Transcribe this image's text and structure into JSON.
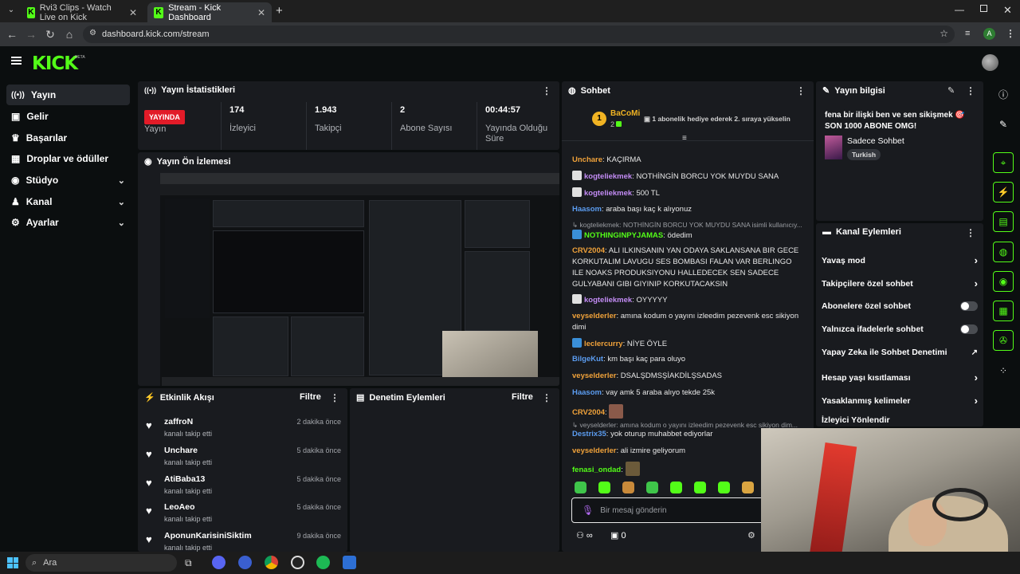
{
  "browser": {
    "tabs": [
      {
        "title": "Rvi3 Clips - Watch Live on Kick",
        "active": false
      },
      {
        "title": "Stream - Kick Dashboard",
        "active": true
      }
    ],
    "url": "dashboard.kick.com/stream",
    "profile_initial": "A"
  },
  "kick": {
    "logo": "KICK",
    "logo_suffix": "BETA"
  },
  "sidebar": {
    "items": [
      {
        "label": "Yayın",
        "icon": "broadcast-icon",
        "active": true,
        "chevron": false
      },
      {
        "label": "Gelir",
        "icon": "revenue-icon",
        "active": false,
        "chevron": false
      },
      {
        "label": "Başarılar",
        "icon": "trophy-icon",
        "active": false,
        "chevron": false
      },
      {
        "label": "Droplar ve ödüller",
        "icon": "gift-icon",
        "active": false,
        "chevron": false
      },
      {
        "label": "Stüdyo",
        "icon": "studio-icon",
        "active": false,
        "chevron": true
      },
      {
        "label": "Kanal",
        "icon": "channel-icon",
        "active": false,
        "chevron": true
      },
      {
        "label": "Ayarlar",
        "icon": "settings-icon",
        "active": false,
        "chevron": true
      }
    ]
  },
  "stats": {
    "title": "Yayın İstatistikleri",
    "live_badge": "YAYINDA",
    "items": [
      {
        "value": "",
        "label": "Yayın"
      },
      {
        "value": "174",
        "label": "İzleyici"
      },
      {
        "value": "1.943",
        "label": "Takipçi"
      },
      {
        "value": "2",
        "label": "Abone Sayısı"
      },
      {
        "value": "00:44:57",
        "label": "Yayında Olduğu Süre"
      }
    ]
  },
  "preview": {
    "title": "Yayın Ön İzlemesi"
  },
  "activity": {
    "title": "Etkinlik Akışı",
    "filter": "Filtre",
    "items": [
      {
        "name": "zaffroN",
        "action": "kanalı takip etti",
        "time": "2 dakika önce"
      },
      {
        "name": "Unchare",
        "action": "kanalı takip etti",
        "time": "5 dakika önce"
      },
      {
        "name": "AtiBaba13",
        "action": "kanalı takip etti",
        "time": "5 dakika önce"
      },
      {
        "name": "LeoAeo",
        "action": "kanalı takip etti",
        "time": "5 dakika önce"
      },
      {
        "name": "AponunKarisiniSiktim",
        "action": "kanalı takip etti",
        "time": "9 dakika önce"
      }
    ]
  },
  "moderation": {
    "title": "Denetim Eylemleri",
    "filter": "Filtre"
  },
  "chat": {
    "title": "Sohbet",
    "pinned_user": "BaCoMi",
    "pinned_count": "2",
    "pinned_rank": "1",
    "pinned_text": "1 abonelik hediye ederek 2. sıraya yükselin",
    "messages": [
      {
        "user": "Unchare",
        "color": "#f0a23a",
        "text": "KAÇIRMA"
      },
      {
        "user": "kogteliekmek",
        "color": "#c38cf5",
        "text": "NOTHİNGİN BORCU YOK MUYDU SANA"
      },
      {
        "user": "kogteliekmek",
        "color": "#c38cf5",
        "text": "500 TL"
      },
      {
        "user": "Haasom",
        "color": "#5b9cf0",
        "text": "araba başı kaç k alıyonuz"
      },
      {
        "user": "NOTHINGINPYJAMAS",
        "color": "#53fc18",
        "text": "ödedim"
      },
      {
        "user": "CRV2004",
        "color": "#f0a23a",
        "text": "ALI ILKINSANIN YAN ODAYA SAKLANSANA BIR GECE KORKUTALIM LAVUGU SES BOMBASI FALAN VAR BERLINGO ILE NOAKS PRODUKSIYONU HALLEDECEK SEN SADECE GULYABANI GIBI GIYINIP KORKUTACAKSIN"
      },
      {
        "user": "kogteliekmek",
        "color": "#c38cf5",
        "text": "OYYYYY"
      },
      {
        "user": "veyselderler",
        "color": "#f0a23a",
        "text": "amına kodum o yayını izleedim pezevenk esc sikiyon dimi"
      },
      {
        "user": "leclercurry",
        "color": "#f0a23a",
        "text": "NİYE ÖYLE"
      },
      {
        "user": "BilgeKut",
        "color": "#5b9cf0",
        "text": "km başı kaç para oluyo"
      },
      {
        "user": "veyselderler",
        "color": "#f0a23a",
        "text": "DSALŞDMSŞİAKDİLŞSADAS"
      },
      {
        "user": "Haasom",
        "color": "#5b9cf0",
        "text": "vay amk 5 araba alıyo tekde 25k"
      },
      {
        "user": "CRV2004",
        "color": "#f0a23a",
        "text": ""
      },
      {
        "user": "Destrix35",
        "color": "#5b9cf0",
        "text": "yok oturup muhabbet ediyorlar"
      },
      {
        "user": "veyselderler",
        "color": "#f0a23a",
        "text": "ali izmire geliyorum"
      },
      {
        "user": "fenasi_ondad",
        "color": "#53fc18",
        "text": ""
      }
    ],
    "reply_1": "kogteliekmek: NOTHİNGİN BORCU YOK MUYDU SANA isimli kullanıcıy...",
    "reply_2": "veyselderler: amına kodum o yayını izleedim pezevenk esc sikiyon dim...",
    "input_placeholder": "Bir mesaj gönderin",
    "gift_count": "0"
  },
  "stream_info": {
    "title": "Yayın bilgisi",
    "stream_title": "fena bir ilişki ben ve sen sikişmek 🎯 SON 1000 ABONE OMG!",
    "category": "Sadece Sohbet",
    "language": "Turkish"
  },
  "channel_actions": {
    "title": "Kanal Eylemleri",
    "items": [
      {
        "label": "Yavaş mod",
        "control": "arrow"
      },
      {
        "label": "Takipçilere özel sohbet",
        "control": "arrow"
      },
      {
        "label": "Abonelere özel sohbet",
        "control": "toggle"
      },
      {
        "label": "Yalnızca ifadelerle sohbet",
        "control": "toggle"
      },
      {
        "label": "Yapay Zeka ile Sohbet Denetimi",
        "control": "external"
      },
      {
        "label": "Hesap yaşı kısıtlaması",
        "control": "arrow"
      },
      {
        "label": "Yasaklanmış kelimeler",
        "control": "arrow"
      },
      {
        "label": "İzleyici Yönlendir",
        "control": "none"
      }
    ]
  },
  "taskbar": {
    "search_label": "Ara"
  },
  "colors": {
    "brand": "#53fc18",
    "live": "#e21b28",
    "panel": "#191b1f"
  }
}
